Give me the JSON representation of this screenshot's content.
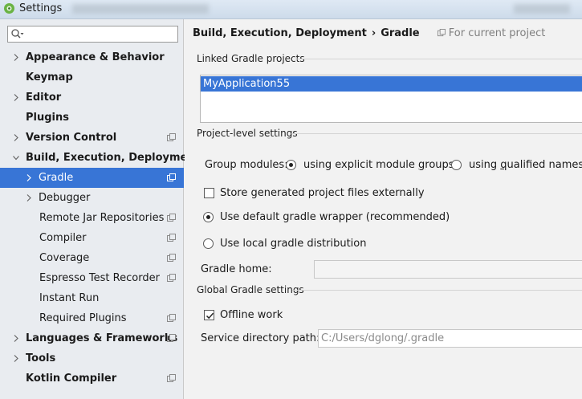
{
  "window": {
    "title": "Settings"
  },
  "search": {
    "placeholder": ""
  },
  "sidebar": {
    "items": [
      {
        "label": "Appearance & Behavior",
        "bold": true
      },
      {
        "label": "Keymap",
        "bold": true
      },
      {
        "label": "Editor",
        "bold": true
      },
      {
        "label": "Plugins",
        "bold": true
      },
      {
        "label": "Version Control",
        "bold": true
      },
      {
        "label": "Build, Execution, Deployment",
        "bold": true
      },
      {
        "label": "Gradle"
      },
      {
        "label": "Debugger"
      },
      {
        "label": "Remote Jar Repositories"
      },
      {
        "label": "Compiler"
      },
      {
        "label": "Coverage"
      },
      {
        "label": "Espresso Test Recorder"
      },
      {
        "label": "Instant Run"
      },
      {
        "label": "Required Plugins"
      },
      {
        "label": "Languages & Frameworks",
        "bold": true
      },
      {
        "label": "Tools",
        "bold": true
      },
      {
        "label": "Kotlin Compiler",
        "bold": true
      }
    ]
  },
  "breadcrumb": {
    "parent": "Build, Execution, Deployment",
    "separator": "›",
    "current": "Gradle",
    "scope": "For current project"
  },
  "linked": {
    "title": "Linked Gradle projects",
    "projects": [
      "MyApplication55"
    ]
  },
  "project_level": {
    "title": "Project-level settings",
    "group_modules_label": "Group modules:",
    "option_explicit_pre": "using explicit module ",
    "option_explicit_u": "g",
    "option_explicit_post": "roups",
    "option_qualified_pre": "using ",
    "option_qualified_u": "q",
    "option_qualified_post": "ualified names",
    "store_external": "Store generated project files externally",
    "use_wrapper": "Use default gradle wrapper (recommended)",
    "use_local": "Use local gradle distribution",
    "gradle_home_label": "Gradle home:",
    "gradle_home_value": ""
  },
  "global": {
    "title": "Global Gradle settings",
    "offline_work": "Offline work",
    "service_dir_label": "Service directory path:",
    "service_dir_value": "C:/Users/dglong/.gradle"
  },
  "colors": {
    "selection": "#3875d6"
  }
}
